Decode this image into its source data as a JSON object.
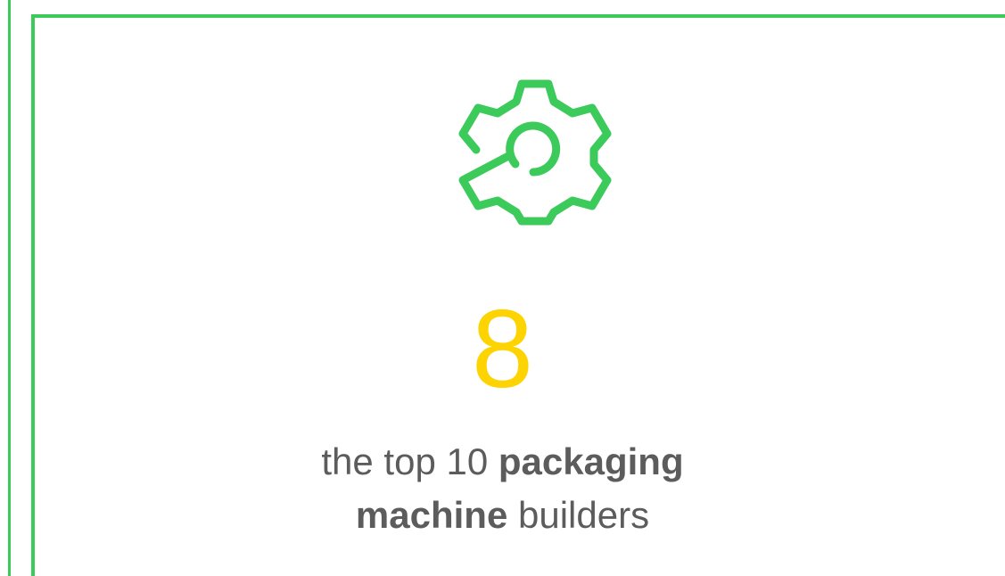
{
  "theme": {
    "accent": "#3ccb5a",
    "number_color": "#fdd301",
    "text_color": "#5c5c5c"
  },
  "stat": {
    "icon": "gear-icon",
    "value": "8",
    "caption": {
      "line1_regular": "the top 10 ",
      "line1_bold": "packaging",
      "line2_bold": "machine",
      "line2_regular": " builders"
    }
  }
}
